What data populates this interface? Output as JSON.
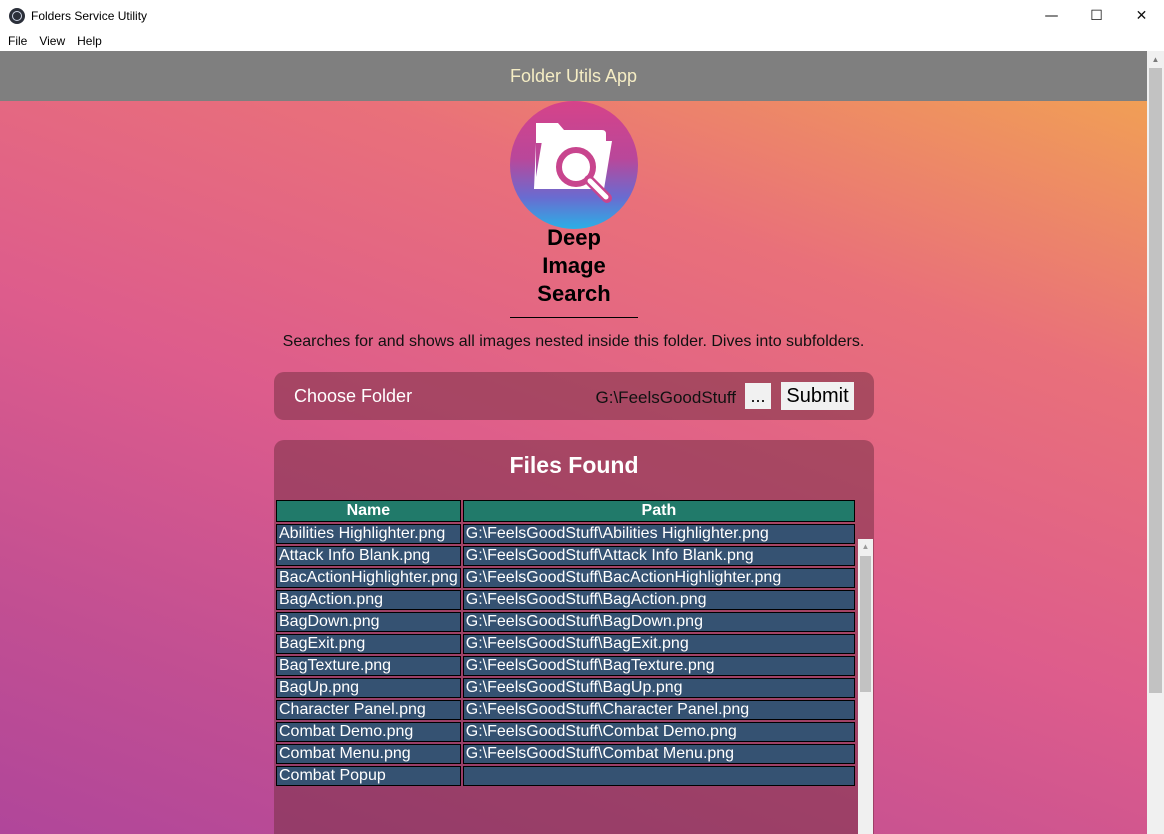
{
  "window": {
    "title": "Folders Service Utility",
    "minimize_glyph": "—",
    "maximize_glyph": "☐",
    "close_glyph": "✕"
  },
  "menu": {
    "items": [
      {
        "label": "File"
      },
      {
        "label": "View"
      },
      {
        "label": "Help"
      }
    ]
  },
  "header": {
    "title": "Folder Utils App"
  },
  "tool": {
    "heading_line1": "Deep",
    "heading_line2": "Image",
    "heading_line3": "Search",
    "description": "Searches for and shows all images nested inside this folder. Dives into subfolders.",
    "logo_icon": "folder-magnifier-icon"
  },
  "chooser": {
    "label": "Choose Folder",
    "path": "G:\\FeelsGoodStuff",
    "browse_label": "...",
    "submit_label": "Submit"
  },
  "results": {
    "title": "Files Found",
    "columns": {
      "name": "Name",
      "path": "Path"
    },
    "rows": [
      {
        "name": "Abilities Highlighter.png",
        "path": "G:\\FeelsGoodStuff\\Abilities Highlighter.png"
      },
      {
        "name": "Attack Info Blank.png",
        "path": "G:\\FeelsGoodStuff\\Attack Info Blank.png"
      },
      {
        "name": "BacActionHighlighter.png",
        "path": "G:\\FeelsGoodStuff\\BacActionHighlighter.png"
      },
      {
        "name": "BagAction.png",
        "path": "G:\\FeelsGoodStuff\\BagAction.png"
      },
      {
        "name": "BagDown.png",
        "path": "G:\\FeelsGoodStuff\\BagDown.png"
      },
      {
        "name": "BagExit.png",
        "path": "G:\\FeelsGoodStuff\\BagExit.png"
      },
      {
        "name": "BagTexture.png",
        "path": "G:\\FeelsGoodStuff\\BagTexture.png"
      },
      {
        "name": "BagUp.png",
        "path": "G:\\FeelsGoodStuff\\BagUp.png"
      },
      {
        "name": "Character Panel.png",
        "path": "G:\\FeelsGoodStuff\\Character Panel.png"
      },
      {
        "name": "Combat Demo.png",
        "path": "G:\\FeelsGoodStuff\\Combat Demo.png"
      },
      {
        "name": "Combat Menu.png",
        "path": "G:\\FeelsGoodStuff\\Combat Menu.png"
      },
      {
        "name": "Combat Popup",
        "path": ""
      }
    ]
  },
  "colors": {
    "header_bg": "#7f7f7f",
    "header_text": "#f5edc4",
    "table_header_bg": "#217a6a",
    "table_cell_bg": "#355272"
  }
}
